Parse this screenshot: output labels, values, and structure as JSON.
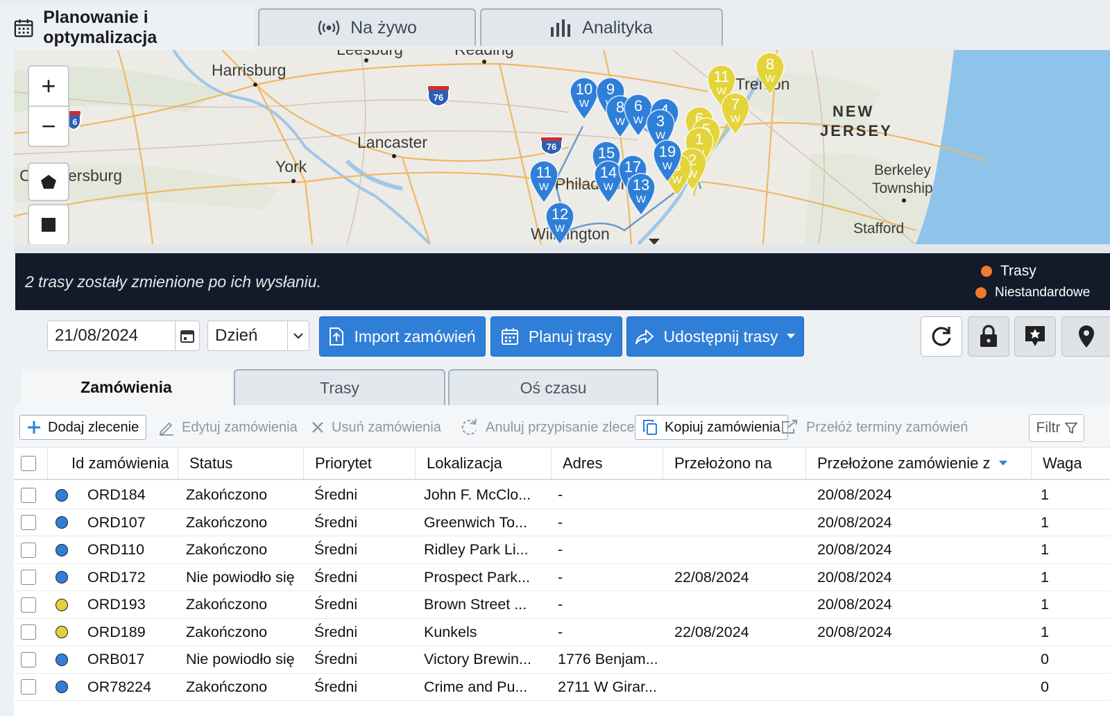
{
  "top_tabs": [
    {
      "label": "Planowanie i optymalizacja",
      "icon": "calendar-icon"
    },
    {
      "label": "Na żywo",
      "icon": "live-broadcast-icon"
    },
    {
      "label": "Analityka",
      "icon": "bar-chart-icon"
    }
  ],
  "map": {
    "cities": [
      "Harrisburg",
      "Lancaster",
      "York",
      "ersburg",
      "Berkeley",
      "Township",
      "Stafford",
      "Leesburg",
      "Reading",
      "Wilmington",
      "Philadelphia",
      "Trenton",
      "C"
    ],
    "state_label": [
      "NEW",
      "JERSEY"
    ],
    "highways": [
      "76",
      "76",
      "6"
    ],
    "zoom_in": "+",
    "zoom_out": "−",
    "markers_blue": [
      {
        "num": "10",
        "sub": "W"
      },
      {
        "num": "9",
        "sub": "W"
      },
      {
        "num": "8",
        "sub": "W"
      },
      {
        "num": "6",
        "sub": "W"
      },
      {
        "num": "4",
        "sub": "W"
      },
      {
        "num": "3",
        "sub": "W"
      },
      {
        "num": "11",
        "sub": "W"
      },
      {
        "num": "15",
        "sub": "W"
      },
      {
        "num": "14",
        "sub": "W"
      },
      {
        "num": "17",
        "sub": "W"
      },
      {
        "num": "13",
        "sub": "W"
      },
      {
        "num": "12",
        "sub": "W"
      },
      {
        "num": "19",
        "sub": "W"
      }
    ],
    "markers_yellow": [
      {
        "num": "8",
        "sub": "W"
      },
      {
        "num": "11",
        "sub": "W"
      },
      {
        "num": "7",
        "sub": "W"
      },
      {
        "num": "6",
        "sub": "W"
      },
      {
        "num": "5",
        "sub": "W"
      },
      {
        "num": "1",
        "sub": "W"
      },
      {
        "num": "2",
        "sub": "W"
      },
      {
        "num": "3",
        "sub": "W"
      }
    ]
  },
  "banner": {
    "message": "2 trasy zostały zmienione po ich wysłaniu.",
    "legend": [
      "Trasy",
      "Niestandardowe"
    ],
    "legend_color": "#f07b2e"
  },
  "toolbar": {
    "date": "21/08/2024",
    "period": "Dzień",
    "import_label": "Import zamówień",
    "plan_label": "Planuj trasy",
    "share_label": "Udostępnij trasy"
  },
  "sub_tabs": [
    "Zamówienia",
    "Trasy",
    "Oś czasu"
  ],
  "actions": {
    "add": "Dodaj zlecenie",
    "edit": "Edytuj zamówienia",
    "delete": "Usuń zamówienia",
    "unassign": "Anuluj przypisanie zleceń",
    "copy": "Kopiuj zamówienia",
    "reschedule": "Przełóż terminy zamówień",
    "filter": "Filtr"
  },
  "table": {
    "columns": [
      "Id zamówienia",
      "Status",
      "Priorytet",
      "Lokalizacja",
      "Adres",
      "Przełożono na",
      "Przełożone zamówienie z",
      "Waga"
    ],
    "rows": [
      {
        "color": "#2f7fd8",
        "id": "ORD184",
        "status": "Zakończono",
        "priority": "Średni",
        "location": "John F. McClo...",
        "address": "-",
        "rescheduled_to": "",
        "rescheduled_from": "20/08/2024",
        "weight": "1"
      },
      {
        "color": "#2f7fd8",
        "id": "ORD107",
        "status": "Zakończono",
        "priority": "Średni",
        "location": "Greenwich To...",
        "address": "-",
        "rescheduled_to": "",
        "rescheduled_from": "20/08/2024",
        "weight": "1"
      },
      {
        "color": "#2f7fd8",
        "id": "ORD110",
        "status": "Zakończono",
        "priority": "Średni",
        "location": "Ridley Park Li...",
        "address": "-",
        "rescheduled_to": "",
        "rescheduled_from": "20/08/2024",
        "weight": "1"
      },
      {
        "color": "#2f7fd8",
        "id": "ORD172",
        "status": "Nie powiodło się",
        "priority": "Średni",
        "location": "Prospect Park...",
        "address": "-",
        "rescheduled_to": "22/08/2024",
        "rescheduled_from": "20/08/2024",
        "weight": "1"
      },
      {
        "color": "#e0d13a",
        "id": "ORD193",
        "status": "Zakończono",
        "priority": "Średni",
        "location": "Brown Street ...",
        "address": "-",
        "rescheduled_to": "",
        "rescheduled_from": "20/08/2024",
        "weight": "1"
      },
      {
        "color": "#e0d13a",
        "id": "ORD189",
        "status": "Zakończono",
        "priority": "Średni",
        "location": "Kunkels",
        "address": "-",
        "rescheduled_to": "22/08/2024",
        "rescheduled_from": "20/08/2024",
        "weight": "1"
      },
      {
        "color": "#2f7fd8",
        "id": "ORB017",
        "status": "Nie powiodło się",
        "priority": "Średni",
        "location": "Victory Brewin...",
        "address": "1776 Benjam...",
        "rescheduled_to": "",
        "rescheduled_from": "",
        "weight": "0"
      },
      {
        "color": "#2f7fd8",
        "id": "OR78224",
        "status": "Zakończono",
        "priority": "Średni",
        "location": "Crime and Pu...",
        "address": "2711 W Girar...",
        "rescheduled_to": "",
        "rescheduled_from": "",
        "weight": "0"
      }
    ]
  }
}
